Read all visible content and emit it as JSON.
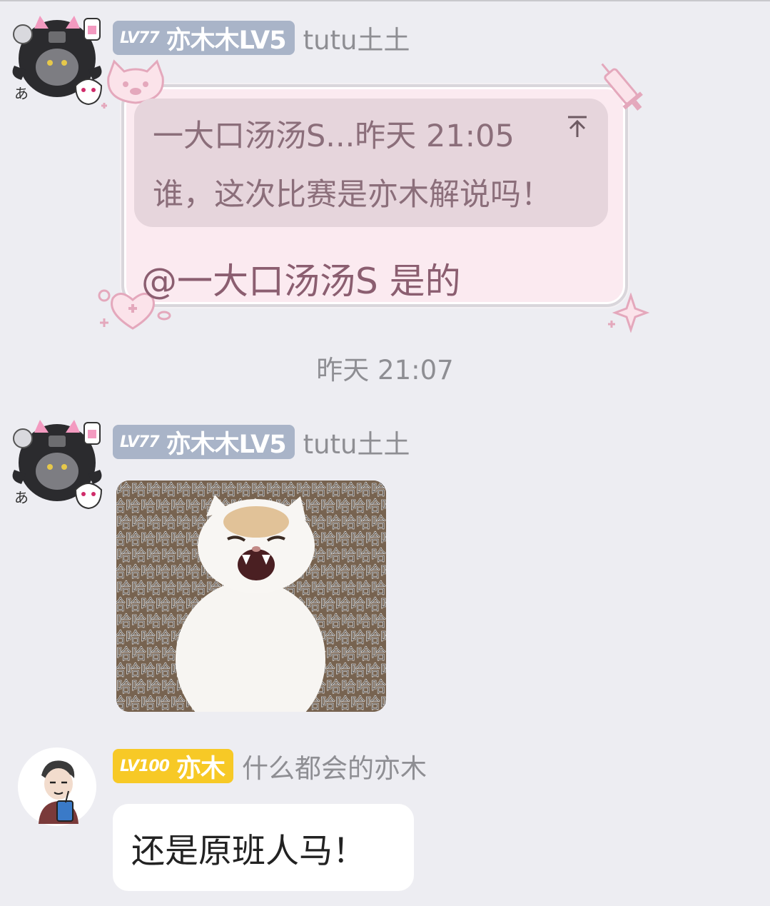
{
  "messages": [
    {
      "sender": {
        "level": "LV77",
        "badge_name": "亦木木LV5",
        "nickname": "tutu土土"
      },
      "quote": {
        "header": "一大口汤汤S...昨天 21:05",
        "text": "谁，这次比赛是亦木解说吗！",
        "icon": "pin-top-icon"
      },
      "text": "@一大口汤汤S 是的"
    },
    {
      "timestamp": "昨天 21:07"
    },
    {
      "sender": {
        "level": "LV77",
        "badge_name": "亦木木LV5",
        "nickname": "tutu土土"
      },
      "image": {
        "type": "sticker",
        "overlay_char": "哈"
      }
    },
    {
      "sender": {
        "level": "LV100",
        "badge_name": "亦木",
        "nickname": "什么都会的亦木"
      },
      "text": "还是原班人马！"
    }
  ],
  "colors": {
    "background": "#ededf2",
    "badge_gray": "#a9b4c8",
    "badge_gold": "#f7c926",
    "bubble_pink": "#fbeaf0",
    "quote_bg": "#e6d5dc",
    "nickname": "#8e8e93"
  }
}
